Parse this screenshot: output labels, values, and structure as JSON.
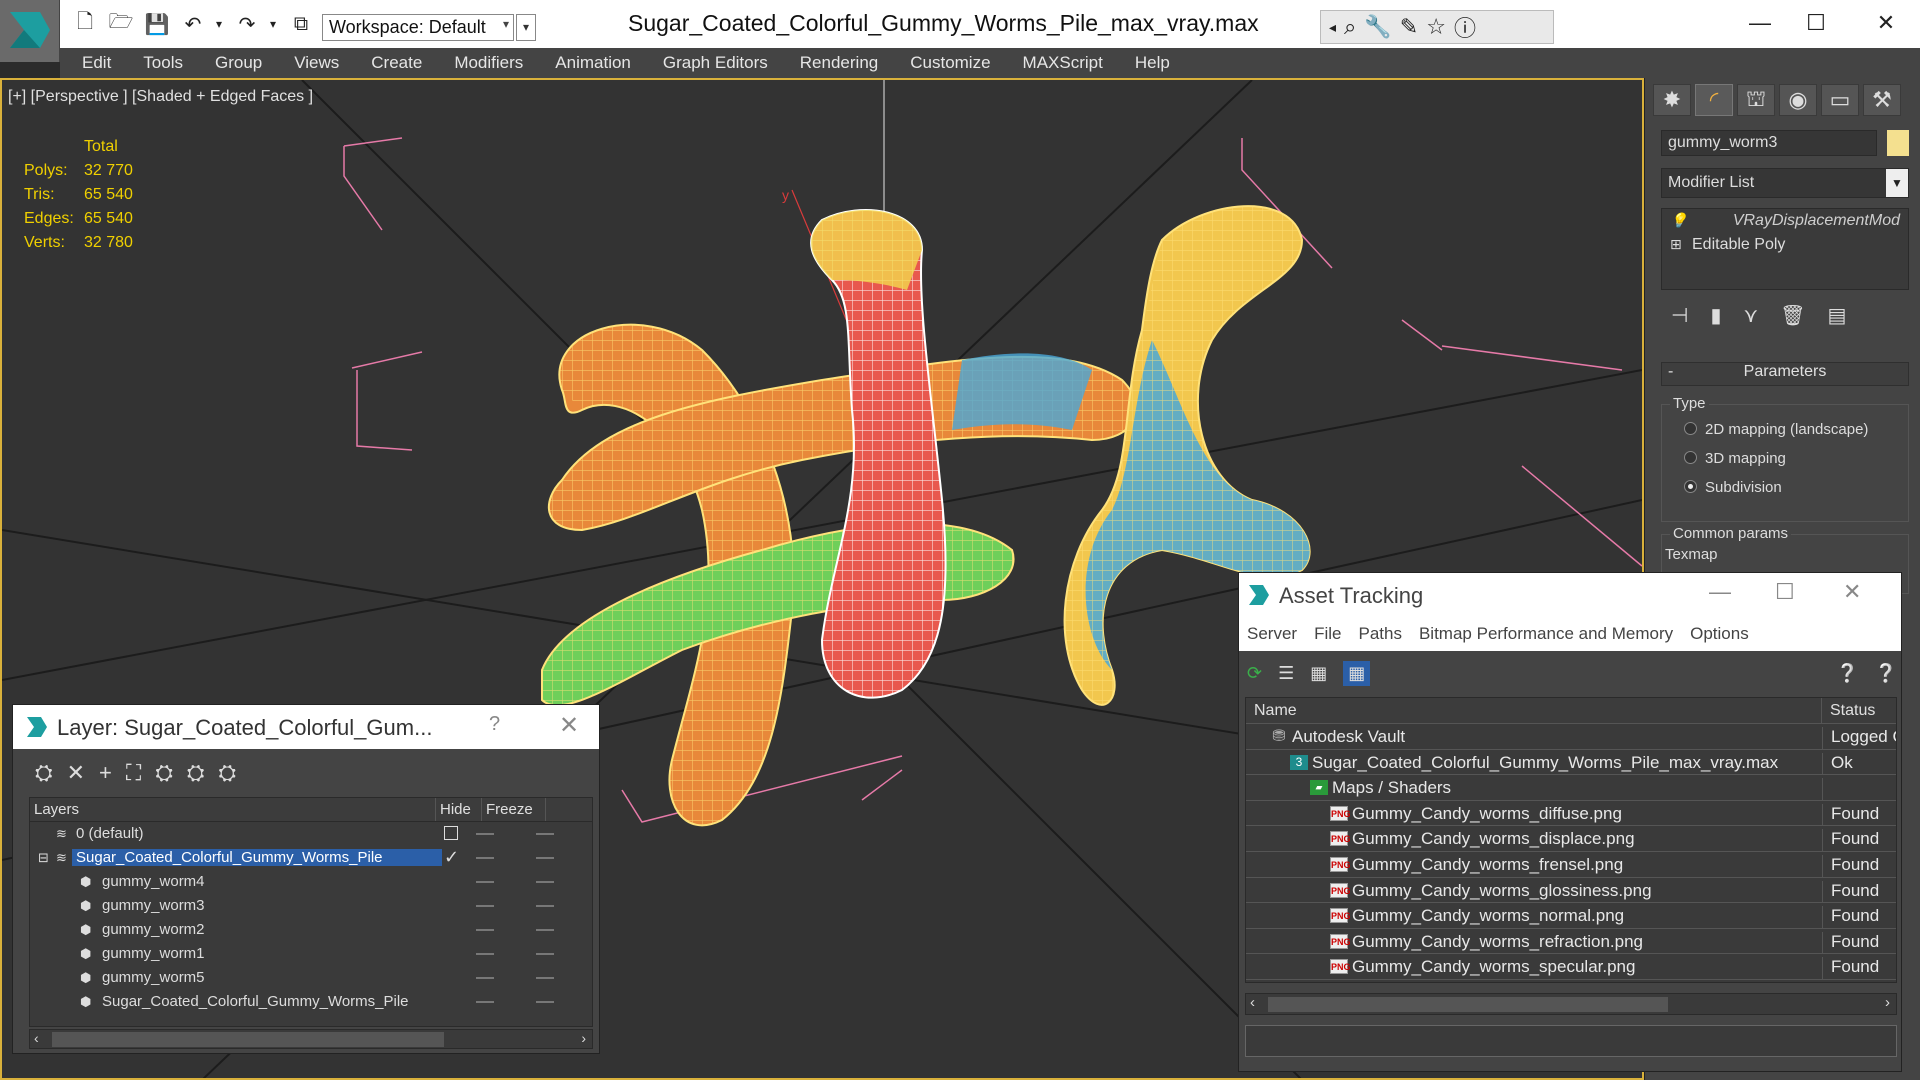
{
  "app": {
    "window_title": "Sugar_Coated_Colorful_Gummy_Worms_Pile_max_vray.max",
    "workspace_label": "Workspace: Default",
    "menu": [
      "Edit",
      "Tools",
      "Group",
      "Views",
      "Create",
      "Modifiers",
      "Animation",
      "Graph Editors",
      "Rendering",
      "Customize",
      "MAXScript",
      "Help"
    ],
    "window_controls": {
      "minimize": "—",
      "maximize": "☐",
      "close": "✕"
    }
  },
  "viewport": {
    "label": "[+] [Perspective ] [Shaded + Edged Faces ]",
    "stats": {
      "header": "Total",
      "rows": [
        {
          "key": "Polys:",
          "value": "32 770"
        },
        {
          "key": "Tris:",
          "value": "65 540"
        },
        {
          "key": "Edges:",
          "value": "65 540"
        },
        {
          "key": "Verts:",
          "value": "32 780"
        }
      ]
    },
    "axis_label": "y"
  },
  "command_panel": {
    "object_name": "gummy_worm3",
    "object_color": "#f4e08f",
    "modifier_list_label": "Modifier List",
    "stack": [
      "VRayDisplacementMod",
      "Editable Poly"
    ],
    "parameters_title": "Parameters",
    "type_group": "Type",
    "type_options": [
      {
        "label": "2D mapping (landscape)",
        "selected": false
      },
      {
        "label": "3D mapping",
        "selected": false
      },
      {
        "label": "Subdivision",
        "selected": true
      }
    ],
    "common_group": "Common params",
    "texmap_label": "Texmap"
  },
  "layer_dialog": {
    "title": "Layer: Sugar_Coated_Colorful_Gum...",
    "help": "?",
    "close": "✕",
    "columns": [
      "Layers",
      "Hide",
      "Freeze"
    ],
    "rows": [
      {
        "name": "0 (default)",
        "indent": 0,
        "selected": false
      },
      {
        "name": "Sugar_Coated_Colorful_Gummy_Worms_Pile",
        "indent": 0,
        "selected": true
      },
      {
        "name": "gummy_worm4",
        "indent": 1,
        "selected": false
      },
      {
        "name": "gummy_worm3",
        "indent": 1,
        "selected": false
      },
      {
        "name": "gummy_worm2",
        "indent": 1,
        "selected": false
      },
      {
        "name": "gummy_worm1",
        "indent": 1,
        "selected": false
      },
      {
        "name": "gummy_worm5",
        "indent": 1,
        "selected": false
      },
      {
        "name": "Sugar_Coated_Colorful_Gummy_Worms_Pile",
        "indent": 1,
        "selected": false
      }
    ]
  },
  "asset_dialog": {
    "title": "Asset Tracking",
    "menu": [
      "Server",
      "File",
      "Paths",
      "Bitmap Performance and Memory",
      "Options"
    ],
    "columns": [
      "Name",
      "Status"
    ],
    "rows": [
      {
        "name": "Autodesk Vault",
        "status": "Logged C",
        "icon": "vault",
        "indent": 0
      },
      {
        "name": "Sugar_Coated_Colorful_Gummy_Worms_Pile_max_vray.max",
        "status": "Ok",
        "icon": "max",
        "indent": 1
      },
      {
        "name": "Maps / Shaders",
        "status": "",
        "icon": "folder",
        "indent": 2
      },
      {
        "name": "Gummy_Candy_worms_diffuse.png",
        "status": "Found",
        "icon": "png",
        "indent": 3
      },
      {
        "name": "Gummy_Candy_worms_displace.png",
        "status": "Found",
        "icon": "png",
        "indent": 3
      },
      {
        "name": "Gummy_Candy_worms_frensel.png",
        "status": "Found",
        "icon": "png",
        "indent": 3
      },
      {
        "name": "Gummy_Candy_worms_glossiness.png",
        "status": "Found",
        "icon": "png",
        "indent": 3
      },
      {
        "name": "Gummy_Candy_worms_normal.png",
        "status": "Found",
        "icon": "png",
        "indent": 3
      },
      {
        "name": "Gummy_Candy_worms_refraction.png",
        "status": "Found",
        "icon": "png",
        "indent": 3
      },
      {
        "name": "Gummy_Candy_worms_specular.png",
        "status": "Found",
        "icon": "png",
        "indent": 3
      }
    ]
  }
}
